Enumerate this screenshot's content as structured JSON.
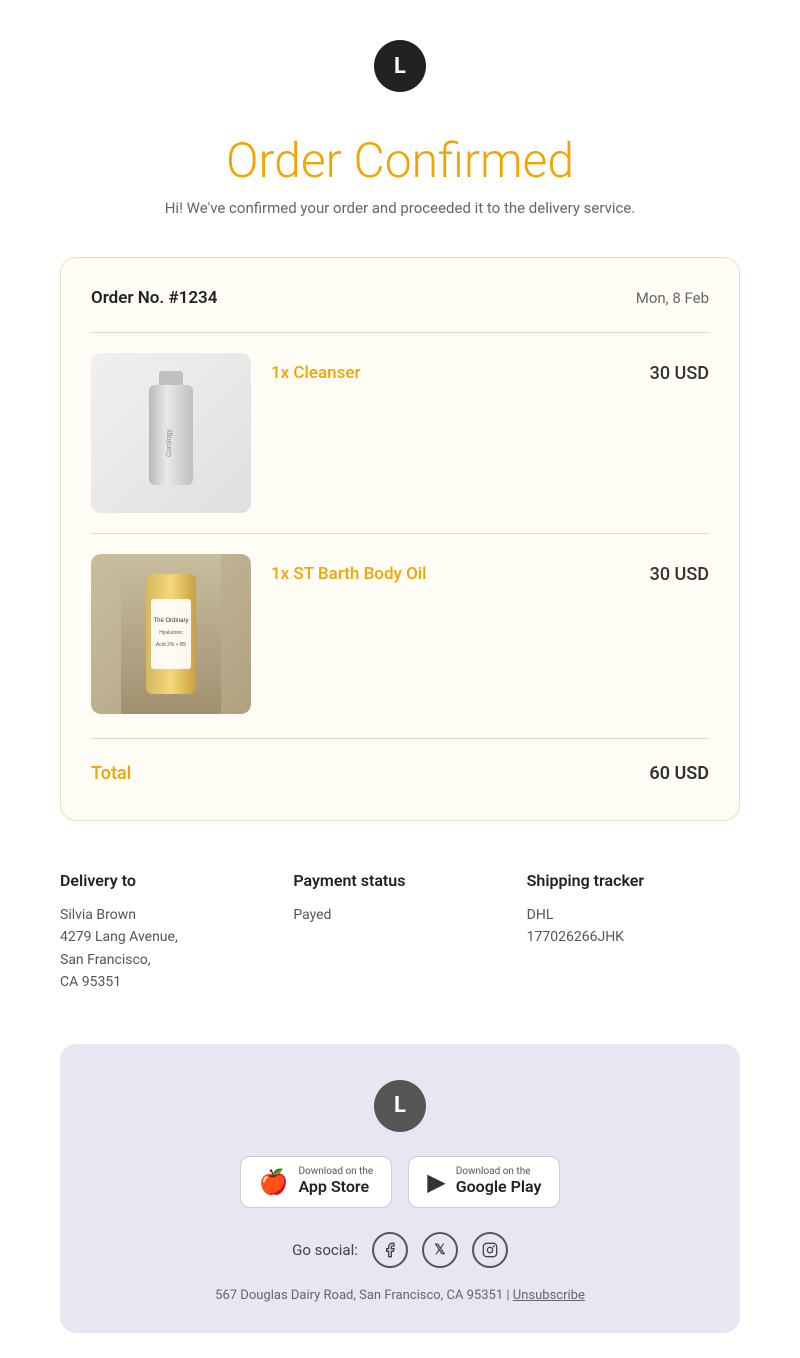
{
  "header": {
    "logo_letter": "L"
  },
  "title": {
    "prefix": "Order",
    "highlight": "Confirmed",
    "subtitle": "Hi! We've confirmed your order and proceeded it to the delivery service."
  },
  "order": {
    "number_label": "Order No. #1234",
    "date": "Mon, 8 Feb",
    "items": [
      {
        "quantity_label": "1x Cleanser",
        "price": "30 USD",
        "image_type": "cleanser"
      },
      {
        "quantity_label": "1x ST Barth Body Oil",
        "price": "30 USD",
        "image_type": "oil"
      }
    ],
    "total_label": "Total",
    "total_price": "60 USD"
  },
  "delivery": {
    "heading": "Delivery to",
    "name": "Silvia Brown",
    "address_line1": "4279 Lang Avenue,",
    "address_line2": "San Francisco,",
    "address_line3": "CA 95351"
  },
  "payment": {
    "heading": "Payment status",
    "status": "Payed"
  },
  "shipping": {
    "heading": "Shipping tracker",
    "carrier": "DHL",
    "tracking": "177026266JHK"
  },
  "footer": {
    "logo_letter": "L",
    "app_store": {
      "small_text": "Download on the",
      "large_text": "App Store",
      "icon": "🍎"
    },
    "google_play": {
      "small_text": "Download on the",
      "large_text": "Google Play",
      "icon": "▶"
    },
    "social_label": "Go social:",
    "address": "567 Douglas Dairy Road, San Francisco, CA 95351 |",
    "unsubscribe": "Unsubscribe"
  }
}
